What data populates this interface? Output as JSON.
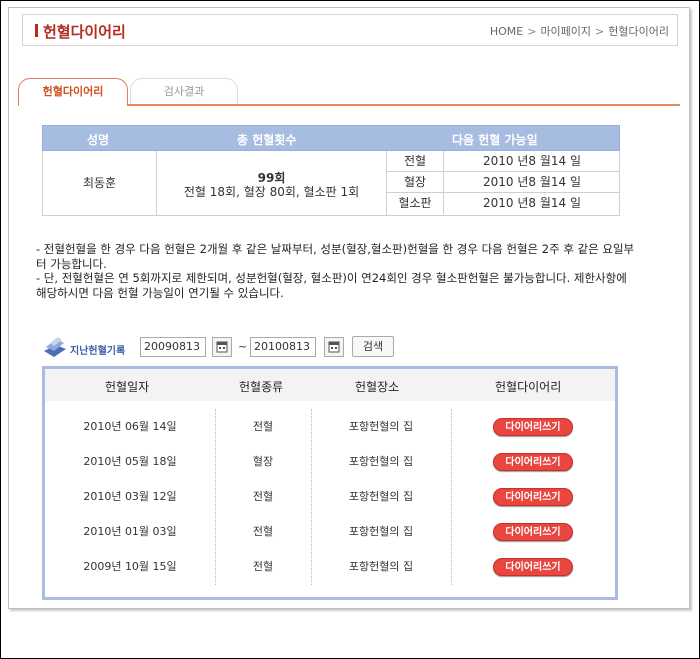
{
  "header": {
    "title": "헌혈다이어리",
    "breadcrumb": [
      "HOME",
      "마이페이지",
      "헌혈다이어리"
    ],
    "breadcrumb_sep": ">"
  },
  "tabs": [
    {
      "label": "헌혈다이어리",
      "active": true
    },
    {
      "label": "검사결과",
      "active": false
    }
  ],
  "summary": {
    "headers": [
      "성명",
      "총 헌혈횟수",
      "다음 헌혈 가능일"
    ],
    "name": "최동훈",
    "total_count": "99회",
    "total_detail": "전혈 18회, 혈장 80회, 혈소판 1회",
    "next_dates": [
      {
        "type": "전혈",
        "date": "2010 년8 월14 일"
      },
      {
        "type": "혈장",
        "date": "2010 년8 월14 일"
      },
      {
        "type": "혈소판",
        "date": "2010 년8 월14 일"
      }
    ]
  },
  "notes": [
    "- 전혈헌혈을 한 경우 다음 헌혈은 2개월 후 같은 날짜부터, 성분(혈장,혈소판)헌혈을 한 경우 다음 헌혈은 2주 후 같은 요일부터 가능합니다.",
    "- 단, 전혈헌혈은 연 5회까지로 제한되며, 성분헌혈(혈장, 혈소판)이 연24회인 경우 혈소판헌혈은 불가능합니다. 제한사항에 해당하시면 다음 헌혈 가능일이 연기될 수 있습니다."
  ],
  "search": {
    "logo_label": "지난헌혈기록",
    "start_date": "20090813",
    "end_date": "20100813",
    "tilde": "~",
    "button_label": "검색"
  },
  "history": {
    "headers": [
      "헌혈일자",
      "헌혈종류",
      "헌혈장소",
      "헌혈다이어리"
    ],
    "rows": [
      {
        "date": "2010년 06월 14일",
        "type": "전혈",
        "place": "포항헌혈의 집",
        "button": "다이어리쓰기"
      },
      {
        "date": "2010년 05월 18일",
        "type": "혈장",
        "place": "포항헌혈의 집",
        "button": "다이어리쓰기"
      },
      {
        "date": "2010년 03월 12일",
        "type": "전혈",
        "place": "포항헌혈의 집",
        "button": "다이어리쓰기"
      },
      {
        "date": "2010년 01월 03일",
        "type": "전혈",
        "place": "포항헌혈의 집",
        "button": "다이어리쓰기"
      },
      {
        "date": "2009년 10월 15일",
        "type": "전혈",
        "place": "포항헌혈의 집",
        "button": "다이어리쓰기"
      }
    ]
  },
  "colors": {
    "title_red": "#b22c1f",
    "tab_accent": "#e08a60",
    "table_header_blue": "#a6bce0",
    "diary_button_red": "#e8463f"
  },
  "icons": [
    "calendar-icon",
    "logo-icon"
  ]
}
